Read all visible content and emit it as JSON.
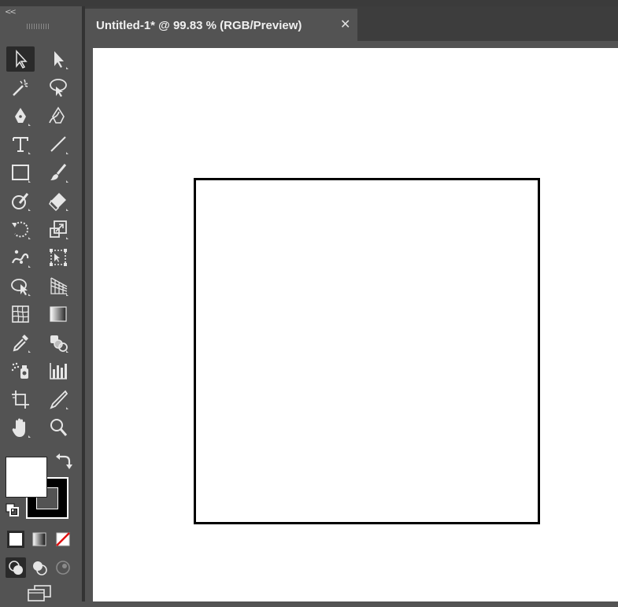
{
  "document_tab": {
    "title": "Untitled-1* @ 99.83 % (RGB/Preview)",
    "close_glyph": "✕"
  },
  "toolbar": {
    "collapse_glyph": "<<",
    "tools": [
      {
        "name": "selection-tool",
        "icon": "selection-icon"
      },
      {
        "name": "direct-selection-tool",
        "icon": "direct-selection-icon"
      },
      {
        "name": "magic-wand-tool",
        "icon": "magic-wand-icon"
      },
      {
        "name": "lasso-tool",
        "icon": "lasso-icon"
      },
      {
        "name": "pen-tool",
        "icon": "pen-icon"
      },
      {
        "name": "curvature-tool",
        "icon": "curvature-icon"
      },
      {
        "name": "type-tool",
        "icon": "type-icon",
        "glyph": "T"
      },
      {
        "name": "line-segment-tool",
        "icon": "line-icon"
      },
      {
        "name": "rectangle-tool",
        "icon": "rectangle-icon"
      },
      {
        "name": "paintbrush-tool",
        "icon": "paintbrush-icon"
      },
      {
        "name": "shaper-tool",
        "icon": "shaper-icon"
      },
      {
        "name": "eraser-tool",
        "icon": "eraser-icon"
      },
      {
        "name": "rotate-tool",
        "icon": "rotate-icon"
      },
      {
        "name": "scale-tool",
        "icon": "scale-icon"
      },
      {
        "name": "puppet-warp-tool",
        "icon": "puppet-warp-icon"
      },
      {
        "name": "free-transform-tool",
        "icon": "free-transform-icon"
      },
      {
        "name": "shape-builder-tool",
        "icon": "shape-builder-icon"
      },
      {
        "name": "perspective-grid-tool",
        "icon": "perspective-grid-icon"
      },
      {
        "name": "mesh-tool",
        "icon": "mesh-icon"
      },
      {
        "name": "gradient-tool",
        "icon": "gradient-icon"
      },
      {
        "name": "eyedropper-tool",
        "icon": "eyedropper-icon"
      },
      {
        "name": "blend-tool",
        "icon": "blend-icon"
      },
      {
        "name": "symbol-sprayer-tool",
        "icon": "symbol-sprayer-icon"
      },
      {
        "name": "column-graph-tool",
        "icon": "column-graph-icon"
      },
      {
        "name": "artboard-tool",
        "icon": "artboard-icon"
      },
      {
        "name": "slice-tool",
        "icon": "slice-icon"
      },
      {
        "name": "hand-tool",
        "icon": "hand-icon"
      },
      {
        "name": "zoom-tool",
        "icon": "zoom-icon"
      }
    ]
  },
  "colors": {
    "fill": "#ffffff",
    "stroke": "#000000",
    "ui_panel": "#535353",
    "ui_dark": "#3d3d3d",
    "artboard": "#ffffff"
  }
}
